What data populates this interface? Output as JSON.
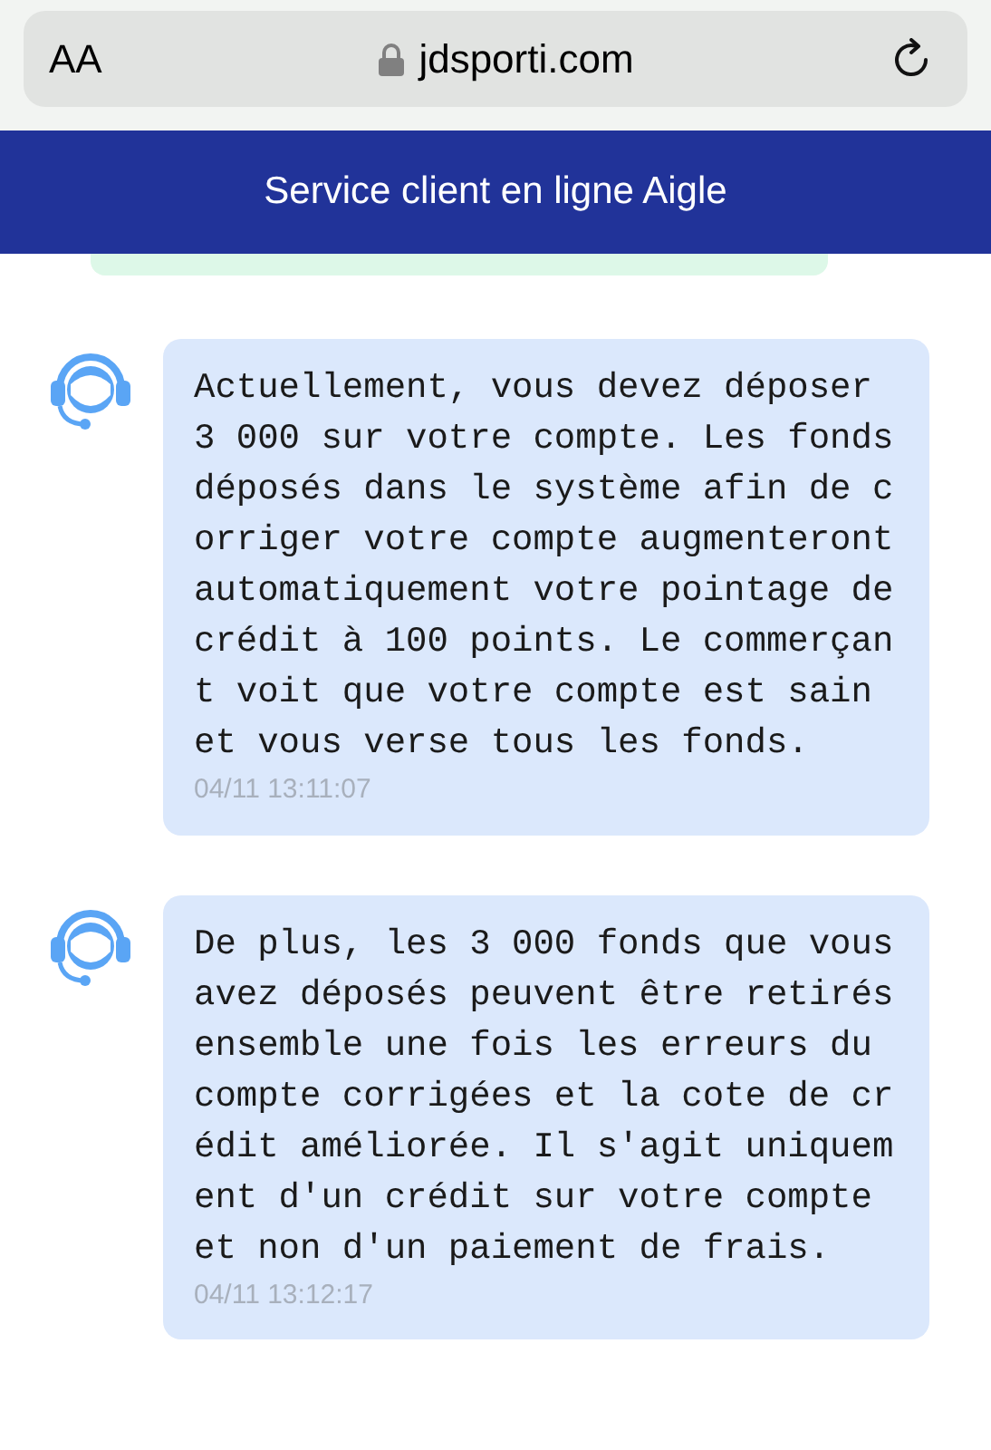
{
  "browser": {
    "text_size_button": "AA",
    "url": "jdsporti.com"
  },
  "header": {
    "title": "Service client en ligne Aigle"
  },
  "messages": [
    {
      "text": "Actuellement, vous devez déposer 3 000 sur votre compte. Les fonds déposés dans le système afin de corriger votre compte augmenteront automatiquement votre pointage de crédit à 100 points. Le commerçant voit que votre compte est sain et vous verse tous les fonds.",
      "time": "04/11 13:11:07"
    },
    {
      "text": "De plus, les 3 000 fonds que vous avez déposés peuvent être retirés ensemble une fois les erreurs du compte corrigées et la cote de crédit améliorée. Il s'agit uniquement d'un crédit sur votre compte et non d'un paiement de frais.",
      "time": "04/11 13:12:17"
    }
  ]
}
